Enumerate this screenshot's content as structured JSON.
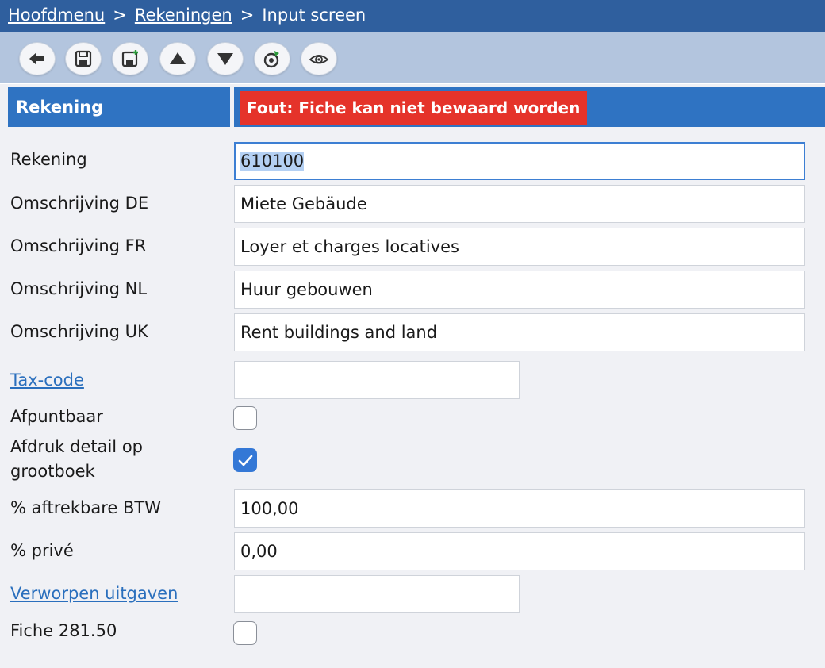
{
  "breadcrumb": {
    "home": "Hoofdmenu",
    "separator": ">",
    "accounts": "Rekeningen",
    "current": "Input screen"
  },
  "toolbar": {
    "icons": [
      "back-arrow-icon",
      "save-icon",
      "save-new-icon",
      "arrow-up-icon",
      "arrow-down-icon",
      "refresh-icon",
      "eye-icon"
    ]
  },
  "header": {
    "section_title": "Rekening",
    "error": "Fout: Fiche kan niet bewaard worden"
  },
  "form": {
    "rekening": {
      "label": "Rekening",
      "value": "610100"
    },
    "omschrijving_de": {
      "label": "Omschrijving DE",
      "value": "Miete Gebäude"
    },
    "omschrijving_fr": {
      "label": "Omschrijving FR",
      "value": "Loyer et charges locatives"
    },
    "omschrijving_nl": {
      "label": "Omschrijving NL",
      "value": "Huur gebouwen"
    },
    "omschrijving_uk": {
      "label": "Omschrijving UK",
      "value": "Rent buildings and land"
    },
    "tax_code": {
      "label": "Tax-code",
      "value": ""
    },
    "afpuntbaar": {
      "label": "Afpuntbaar",
      "checked": false
    },
    "afdruk_detail": {
      "label_line1": "Afdruk detail op",
      "label_line2": "grootboek",
      "checked": true
    },
    "aftrekbare_btw": {
      "label": "% aftrekbare BTW",
      "value": "100,00"
    },
    "prive": {
      "label": "% privé",
      "value": "0,00"
    },
    "verworpen_uitgaven": {
      "label": "Verworpen uitgaven",
      "value": ""
    },
    "fiche_28150": {
      "label": "Fiche 281.50",
      "checked": false
    }
  },
  "colors": {
    "topbar": "#2f5f9e",
    "toolbar": "#b3c5de",
    "header": "#2f73c2",
    "error": "#e5332a",
    "link": "#2a6fbd",
    "checkbox_checked": "#3478d6"
  }
}
